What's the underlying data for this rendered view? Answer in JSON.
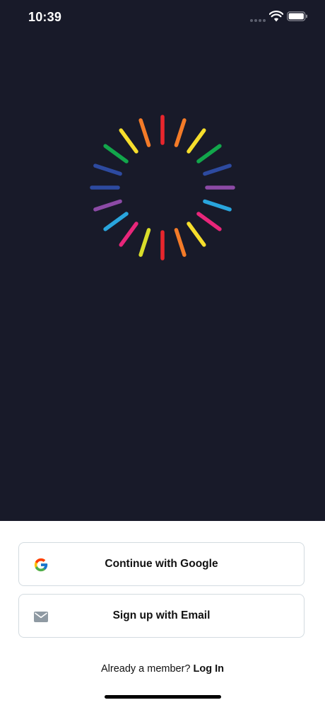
{
  "status_bar": {
    "time": "10:39"
  },
  "logo": {
    "icon": "rainbow-burst-logo",
    "ray_colors": [
      "#e8262d",
      "#f47b28",
      "#f6de2c",
      "#12a64b",
      "#2d4aa0",
      "#8c4aa6",
      "#29a5dd",
      "#e8267a",
      "#f6de2c",
      "#f47b28",
      "#e8262d",
      "#d9dd2a",
      "#e8267a",
      "#29a5dd",
      "#8c4aa6",
      "#2d4aa0",
      "#2d4aa0",
      "#12a64b",
      "#f6de2c",
      "#f47b28"
    ]
  },
  "colors": {
    "hero_background": "#181a29",
    "button_border": "#d3dbe0"
  },
  "auth": {
    "google_button_label": "Continue with Google",
    "email_button_label": "Sign up with Email",
    "already_member_text": "Already a member? ",
    "login_link_label": "Log In"
  }
}
